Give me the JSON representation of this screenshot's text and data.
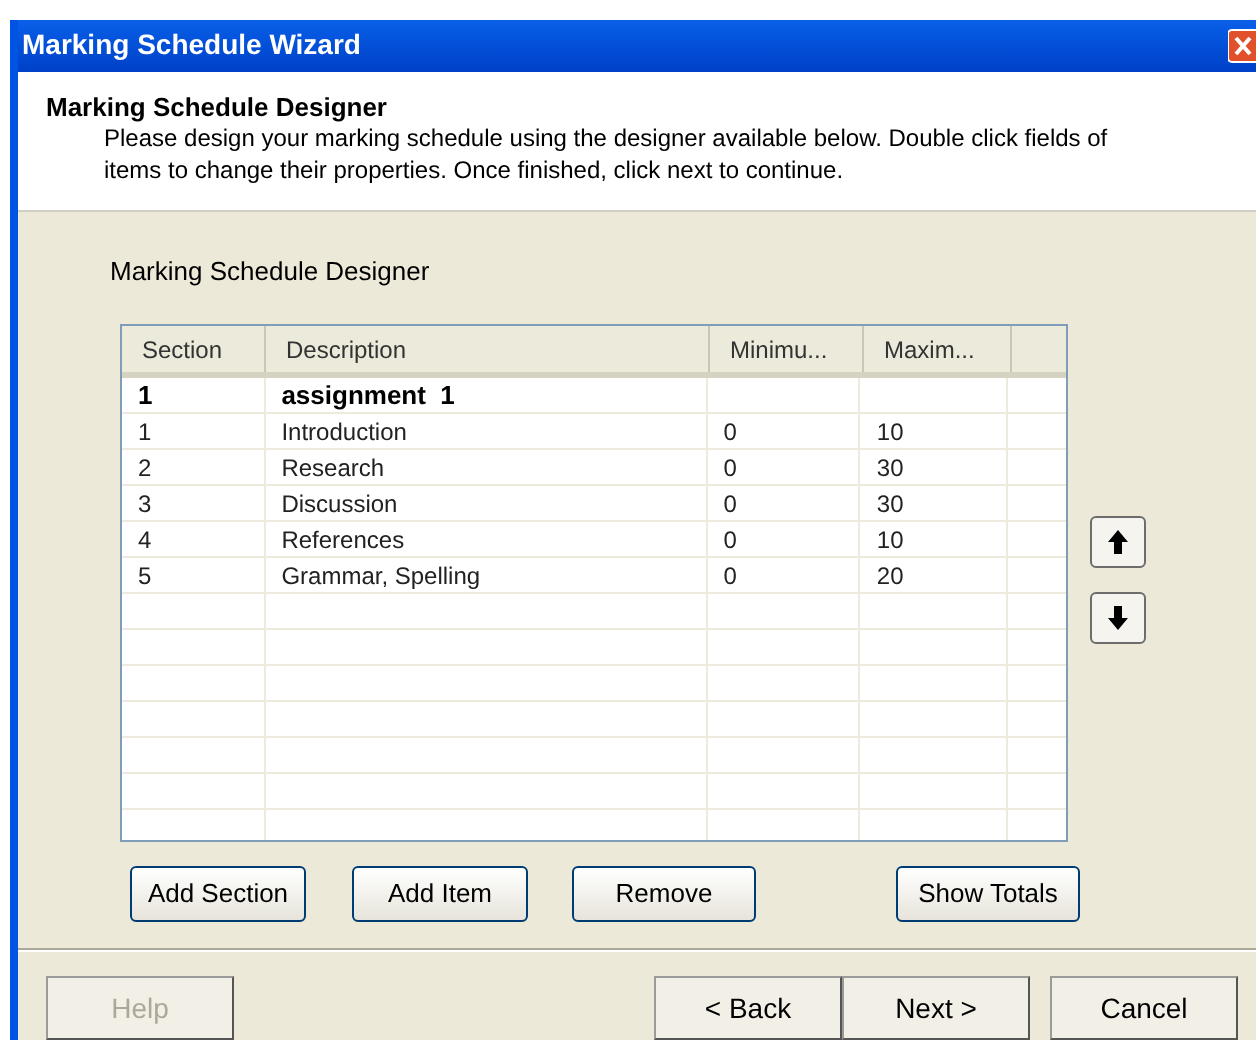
{
  "window": {
    "title": "Marking Schedule Wizard"
  },
  "header": {
    "title": "Marking Schedule Designer",
    "description": "Please design your marking schedule using the designer available below. Double click fields of items to change their properties. Once finished, click next to continue."
  },
  "group_label": "Marking Schedule Designer",
  "table": {
    "columns": [
      "Section",
      "Description",
      "Minimu...",
      "Maxim..."
    ],
    "rows": [
      {
        "kind": "section",
        "cells": [
          "1",
          "assignment  1",
          "",
          ""
        ]
      },
      {
        "kind": "item",
        "cells": [
          "1",
          "Introduction",
          "0",
          "10"
        ]
      },
      {
        "kind": "item",
        "cells": [
          "2",
          "Research",
          "0",
          "30"
        ]
      },
      {
        "kind": "item",
        "cells": [
          "3",
          "Discussion",
          "0",
          "30"
        ]
      },
      {
        "kind": "item",
        "cells": [
          "4",
          "References",
          "0",
          "10"
        ]
      },
      {
        "kind": "item",
        "cells": [
          "5",
          "Grammar, Spelling",
          "0",
          "20"
        ]
      }
    ]
  },
  "actions": [
    "Add Section",
    "Add Item",
    "Remove",
    "Show Totals"
  ],
  "footer_buttons": [
    {
      "label": "Help",
      "disabled": true
    },
    {
      "label": "< Back",
      "disabled": false
    },
    {
      "label": "Next >",
      "disabled": false
    },
    {
      "label": "Cancel",
      "disabled": false
    }
  ]
}
